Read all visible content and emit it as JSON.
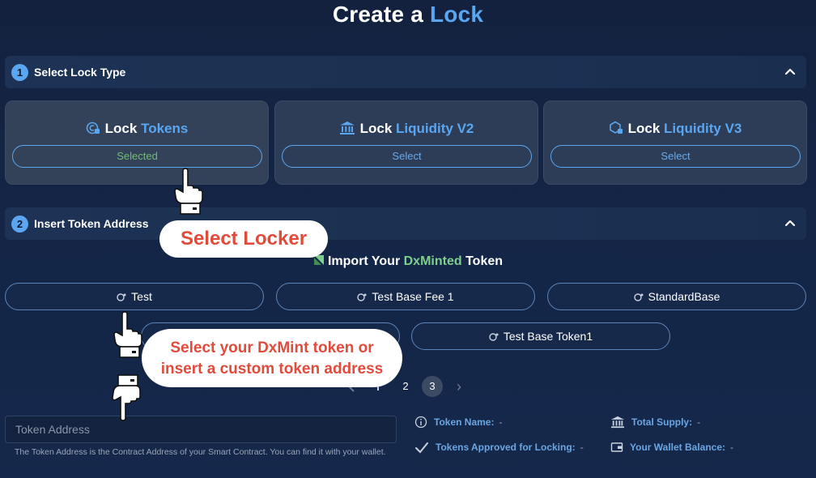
{
  "header": {
    "title_prefix": "Create a",
    "title_accent": "Lock"
  },
  "section1": {
    "number": "1",
    "label": "Select Lock Type"
  },
  "lock_types": [
    {
      "icon": "coin-lock-icon",
      "title_main": "Lock",
      "title_accent": "Tokens",
      "button": "Selected",
      "selected": true
    },
    {
      "icon": "bank-icon",
      "title_main": "Lock",
      "title_accent": "Liquidity V2",
      "button": "Select",
      "selected": false
    },
    {
      "icon": "hexagon-lock-icon",
      "title_main": "Lock",
      "title_accent": "Liquidity V3",
      "button": "Select",
      "selected": false
    }
  ],
  "section2": {
    "number": "2",
    "label": "Insert Token Address"
  },
  "import": {
    "prefix": "Import Your",
    "brand": "DxMinted",
    "suffix": "Token"
  },
  "tokens": [
    "Test",
    "Test Base Fee 1",
    "StandardBase",
    "Test Base Token1"
  ],
  "pagination": {
    "pages": [
      "2",
      "3"
    ],
    "active": "3",
    "next": "›"
  },
  "token_address": {
    "placeholder": "Token Address",
    "helper": "The Token Address is the Contract Address of your Smart Contract. You can find it with your wallet."
  },
  "info": {
    "token_name_label": "Token Name:",
    "token_name_value": "-",
    "total_supply_label": "Total Supply:",
    "total_supply_value": "-",
    "approved_label": "Tokens Approved for Locking:",
    "approved_value": "-",
    "balance_label": "Your Wallet Balance:",
    "balance_value": "-"
  },
  "callouts": {
    "select_locker": "Select Locker",
    "select_token_line1": "Select your DxMint token or",
    "select_token_line2": "insert a custom token address"
  },
  "colors": {
    "accent": "#5aa6f0",
    "brand_green": "#7dcf8a",
    "callout_red": "#e04b3c",
    "background": "#13213e"
  }
}
